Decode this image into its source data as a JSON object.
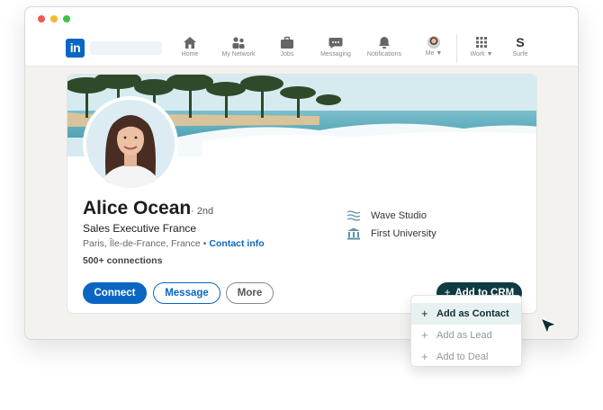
{
  "navbar": {
    "logo_text": "in",
    "items": [
      {
        "label": "Home",
        "icon": "home-icon"
      },
      {
        "label": "My Network",
        "icon": "network-icon"
      },
      {
        "label": "Jobs",
        "icon": "briefcase-icon"
      },
      {
        "label": "Messaging",
        "icon": "message-icon"
      },
      {
        "label": "Notifications",
        "icon": "bell-icon"
      },
      {
        "label": "Me ▼",
        "icon": "avatar"
      },
      {
        "label": "Work ▼",
        "icon": "grid-icon"
      },
      {
        "label": "Surfe",
        "icon": "surfe-icon"
      }
    ],
    "surfe_glyph": "S"
  },
  "profile": {
    "name": "Alice Ocean",
    "degree": "· 2nd",
    "headline": "Sales Executive France",
    "location": "Paris, Île-de-France, France",
    "separator": "•",
    "contact_info": "Contact info",
    "connections": "500+ connections",
    "experience": [
      {
        "label": "Wave Studio",
        "icon": "waves-icon"
      },
      {
        "label": "First University",
        "icon": "university-icon"
      }
    ]
  },
  "actions": {
    "connect": "Connect",
    "message": "Message",
    "more": "More",
    "add_to_crm": "Add to CRM",
    "plus": "+"
  },
  "crm_menu": {
    "items": [
      {
        "label": "Add as Contact",
        "state": "hover"
      },
      {
        "label": "Add as Lead",
        "state": "normal"
      },
      {
        "label": "Add to Deal",
        "state": "normal"
      }
    ]
  },
  "colors": {
    "linkedin_blue": "#0a66c2",
    "crm_dark": "#0f3b42",
    "menu_hover": "#e8f1f1"
  }
}
